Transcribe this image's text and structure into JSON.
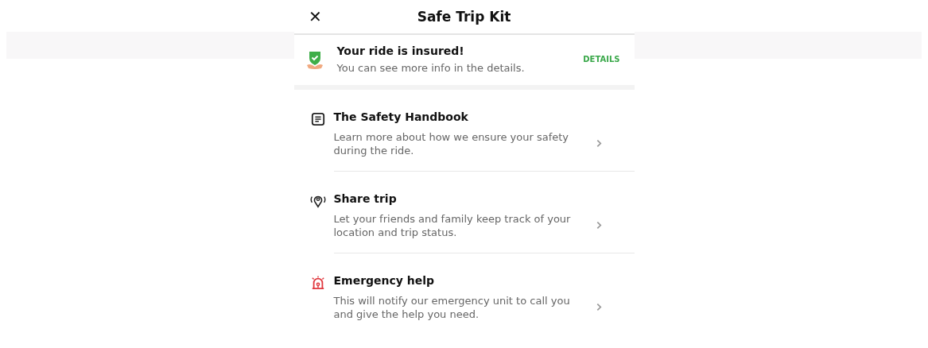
{
  "header": {
    "close_icon": "✕",
    "title": "Safe Trip Kit"
  },
  "insurance": {
    "title": "Your ride is insured!",
    "text": "You can see more info in the details.",
    "action": "DETAILS"
  },
  "items": [
    {
      "kind": "document",
      "title": "The Safety Handbook",
      "text": "Learn more about how we ensure your safety during the ride."
    },
    {
      "kind": "location",
      "title": "Share trip",
      "text": "Let your friends and family keep track of your location and trip status."
    },
    {
      "kind": "alarm",
      "title": "Emergency help",
      "text": "This will notify our emergency unit to call you and give the help you need."
    }
  ]
}
